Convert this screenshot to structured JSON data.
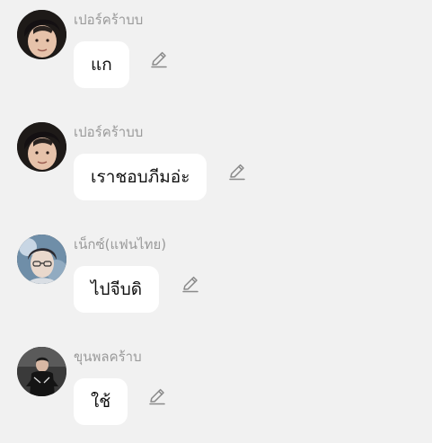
{
  "messages": [
    {
      "sender": "เปอร์คร้าบบ",
      "text": "แก",
      "avatar_icon": "user-avatar-1",
      "edit_icon": "pencil-icon"
    },
    {
      "sender": "เปอร์คร้าบบ",
      "text": "เราชอบภีมอ่ะ",
      "avatar_icon": "user-avatar-1",
      "edit_icon": "pencil-icon"
    },
    {
      "sender": "เน็กซ์(แฟนไทย)",
      "text": "ไปจีบดิ",
      "avatar_icon": "user-avatar-2",
      "edit_icon": "pencil-icon"
    },
    {
      "sender": "ขุนพลคร้าบ",
      "text": "ใช้",
      "avatar_icon": "user-avatar-3",
      "edit_icon": "pencil-icon"
    }
  ],
  "colors": {
    "background": "#f1f1f1",
    "bubble": "#ffffff",
    "sender_text": "#9a9a9a",
    "message_text": "#111111",
    "edit_icon": "#8a8a8a"
  }
}
